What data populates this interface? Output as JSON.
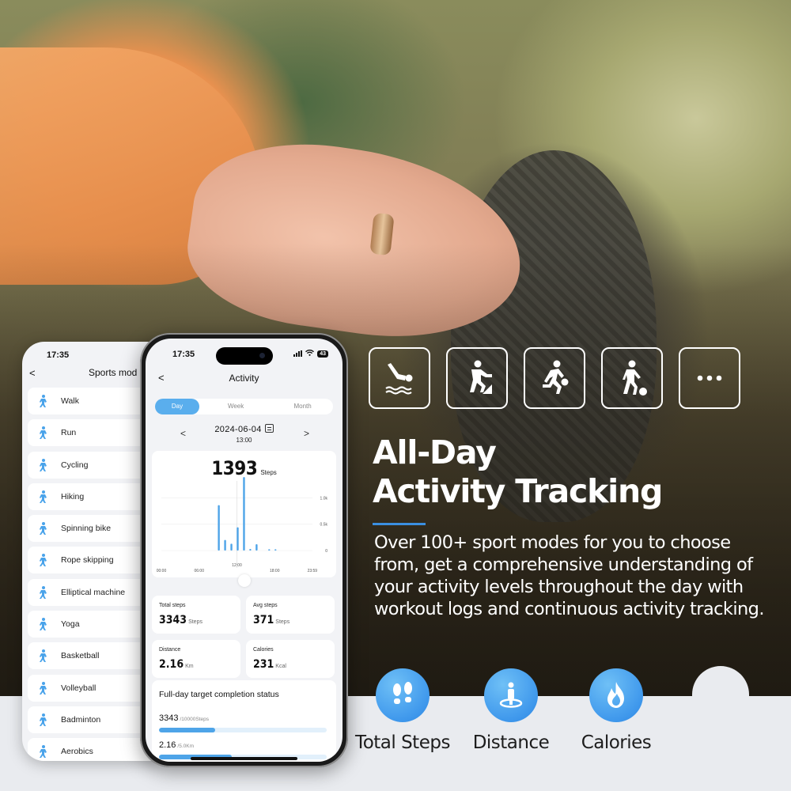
{
  "hero": {
    "headline_line1": "All-Day",
    "headline_line2": "Activity Tracking",
    "body": "Over 100+ sport modes for you to choose from, get a comprehensive understanding of your activity levels throughout the day with workout logs and continuous activity tracking.",
    "accent_color": "#3b8fe0",
    "sport_icons": [
      "diving-icon",
      "hiking-icon",
      "basketball-icon",
      "football-icon",
      "more-icon"
    ]
  },
  "metrics": [
    {
      "label": "Total Steps",
      "icon": "footprints-icon"
    },
    {
      "label": "Distance",
      "icon": "location-person-icon"
    },
    {
      "label": "Calories",
      "icon": "flame-icon"
    }
  ],
  "sports_phone": {
    "status_time": "17:35",
    "title": "Sports mod",
    "back_glyph": "<",
    "items": [
      {
        "label": "Walk",
        "icon": "walk-icon",
        "glyph": "🚶"
      },
      {
        "label": "Run",
        "icon": "run-icon",
        "glyph": "🏃"
      },
      {
        "label": "Cycling",
        "icon": "cycling-icon",
        "glyph": "🚴"
      },
      {
        "label": "Hiking",
        "icon": "hiking-icon",
        "glyph": "🥾"
      },
      {
        "label": "Spinning bike",
        "icon": "spinning-bike-icon",
        "glyph": "🚲"
      },
      {
        "label": "Rope skipping",
        "icon": "rope-skipping-icon",
        "glyph": "➰"
      },
      {
        "label": "Elliptical machine",
        "icon": "elliptical-icon",
        "glyph": "⛹"
      },
      {
        "label": "Yoga",
        "icon": "yoga-icon",
        "glyph": "🧘"
      },
      {
        "label": "Basketball",
        "icon": "basketball-icon",
        "glyph": "⛹"
      },
      {
        "label": "Volleyball",
        "icon": "volleyball-icon",
        "glyph": "🏐"
      },
      {
        "label": "Badminton",
        "icon": "badminton-icon",
        "glyph": "🏸"
      },
      {
        "label": "Aerobics",
        "icon": "aerobics-icon",
        "glyph": "🤸"
      }
    ]
  },
  "activity_phone": {
    "status_time": "17:35",
    "battery": "43",
    "title": "Activity",
    "back_glyph": "<",
    "tabs": [
      {
        "label": "Day",
        "active": true
      },
      {
        "label": "Week",
        "active": false
      },
      {
        "label": "Month",
        "active": false
      }
    ],
    "date": "2024-06-04",
    "time": "13:00",
    "prev_glyph": "<",
    "next_glyph": ">",
    "steps_value": "1393",
    "steps_unit": "Steps",
    "stats": [
      {
        "label": "Total steps",
        "value": "3343",
        "unit": "Steps"
      },
      {
        "label": "Avg steps",
        "value": "371",
        "unit": "Steps"
      },
      {
        "label": "Distance",
        "value": "2.16",
        "unit": "Km"
      },
      {
        "label": "Calories",
        "value": "231",
        "unit": "Kcal"
      }
    ],
    "target": {
      "title": "Full-day target completion status",
      "rows": [
        {
          "value": "3343",
          "goal": "/10000Steps",
          "progress": 0.334
        },
        {
          "value": "2.16",
          "goal": "/5.0Km",
          "progress": 0.432
        }
      ]
    }
  },
  "chart_data": {
    "type": "bar",
    "title": "",
    "xlabel": "",
    "ylabel": "Steps",
    "x_ticks": [
      "00:00",
      "06:00",
      "12:00",
      "18:00",
      "23:59"
    ],
    "y_ticks": [
      "0",
      "0.5k",
      "1.0k"
    ],
    "ylim": [
      0,
      1200
    ],
    "x_range_hours": [
      0,
      24
    ],
    "selected_hour": 12,
    "x": [
      9,
      10,
      11,
      12,
      13,
      14,
      15,
      17,
      18
    ],
    "values": [
      860,
      200,
      130,
      440,
      1393,
      30,
      120,
      10,
      10
    ],
    "bar_color": "#4ea4e8",
    "grid": true
  }
}
